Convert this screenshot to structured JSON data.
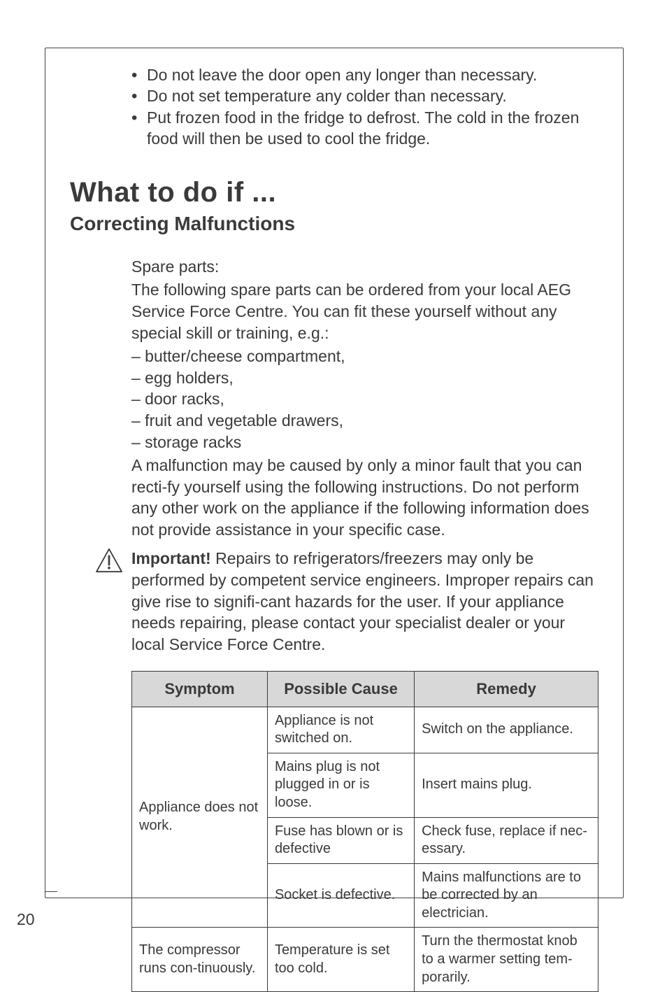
{
  "bullets": [
    "Do not leave the door open any longer than necessary.",
    "Do not set temperature any colder than necessary.",
    "Put frozen food in the fridge to defrost. The cold in the frozen food will then be used to cool the fridge."
  ],
  "heading": "What to do if ...",
  "subheading": "Correcting Malfunctions",
  "spare_label": "Spare parts:",
  "spare_intro": "The following spare parts can be ordered from your local AEG Service Force Centre. You can fit these yourself without any special skill or training, e.g.:",
  "spare_items": [
    "– butter/cheese compartment,",
    "– egg holders,",
    "– door racks,",
    "– fruit and vegetable drawers,",
    "– storage racks"
  ],
  "malfunction_para": "A malfunction may be caused by only a minor fault that you can recti-fy yourself using the following instructions. Do not perform any other work on the appliance if the following information does not provide assistance in your specific case.",
  "important_label": "Important!",
  "important_text": " Repairs to refrigerators/freezers may only be performed by competent service engineers. Improper repairs can give rise to signifi-cant hazards for the user. If your appliance needs repairing, please contact your specialist dealer or your local Service Force Centre.",
  "table": {
    "headers": {
      "c0": "Symptom",
      "c1": "Possible Cause",
      "c2": "Remedy"
    },
    "group1_symptom": "Appliance does not work.",
    "group1": [
      {
        "cause": "Appliance is not switched on.",
        "remedy": "Switch on the appliance."
      },
      {
        "cause": "Mains plug is not plugged in or is loose.",
        "remedy": "Insert mains plug."
      },
      {
        "cause": "Fuse has blown or is defective",
        "remedy": "Check fuse, replace if nec-essary."
      },
      {
        "cause": "Socket is defective.",
        "remedy": "Mains malfunctions are to be corrected by an electrician."
      }
    ],
    "row2": {
      "symptom": "The compressor runs con-tinuously.",
      "cause": "Temperature is set too cold.",
      "remedy": "Turn the thermostat knob to a warmer setting tem-porarily."
    }
  },
  "page_number": "20"
}
